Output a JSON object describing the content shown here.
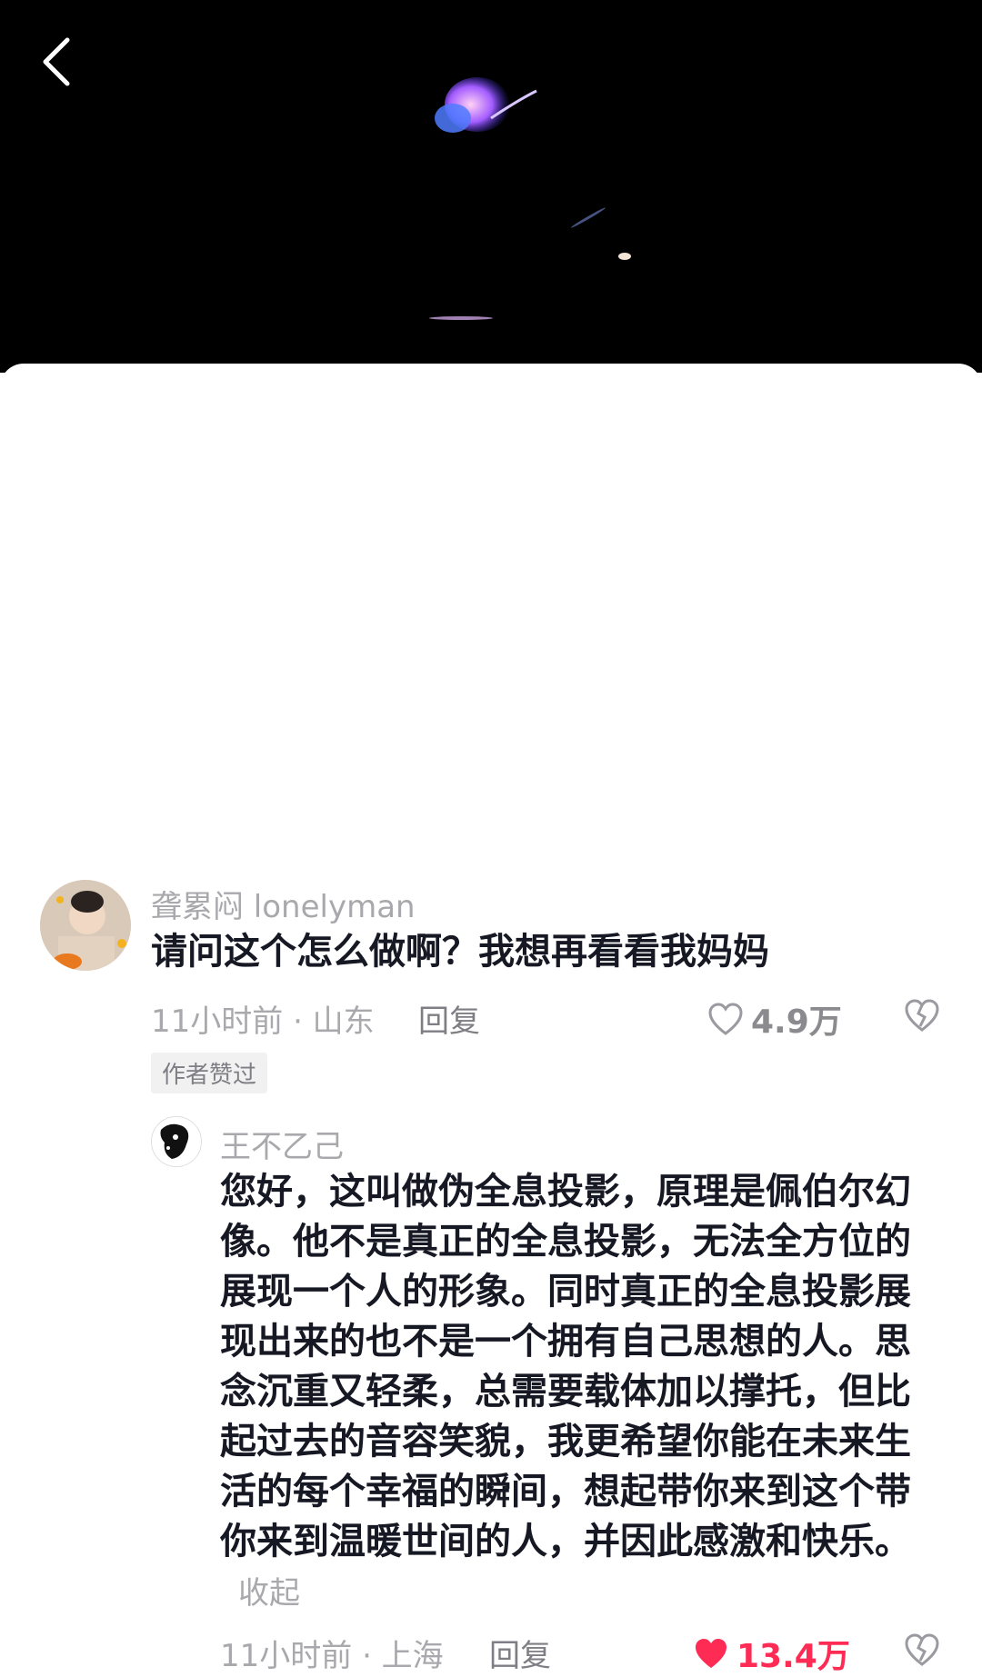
{
  "top_bar": {
    "back_icon": "chevron-left-icon"
  },
  "comment": {
    "username": "聋累闷 lonelyman",
    "text": "请问这个怎么做啊？我想再看看我妈妈",
    "time_location": "11小时前 · 山东",
    "reply_label": "回复",
    "like_count": "4.9万",
    "author_badge": "作者赞过"
  },
  "reply": {
    "username": "王不乙己",
    "text": "您好，这叫做伪全息投影，原理是佩伯尔幻像。他不是真正的全息投影，无法全方位的展现一个人的形象。同时真正的全息投影展现出来的也不是一个拥有自己思想的人。思念沉重又轻柔，总需要载体加以撑托，但比起过去的音容笑貌，我更希望你能在未来生活的每个幸福的瞬间，想起带你来到这个带你来到温暖世间的人，并因此感激和快乐。",
    "collapse_label": "收起",
    "time_location": "11小时前 · 上海",
    "reply_label": "回复",
    "like_count": "13.4万",
    "liked_color": "#fe2c55"
  }
}
